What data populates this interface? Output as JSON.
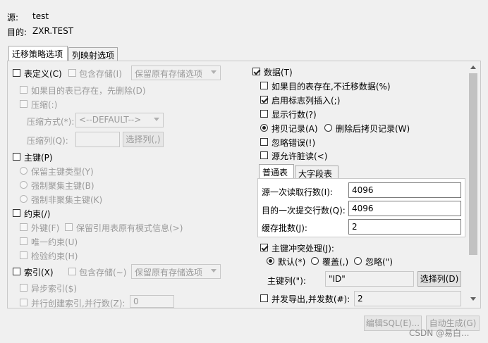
{
  "header": {
    "source_label": "源:",
    "source_value": "test",
    "target_label": "目的:",
    "target_value": "ZXR.TEST"
  },
  "tabs": [
    "迁移策略选项",
    "列映射选项"
  ],
  "left": {
    "table_def": "表定义(C)",
    "include_storage": "包含存储(I)",
    "keep_storage_option": "保留原有存储选项",
    "drop_if_exists": "如果目的表已存在，先删除(D)",
    "compress": "压缩(:)",
    "compress_method_label": "压缩方式(*):",
    "compress_method_value": "<--DEFAULT-->",
    "compress_col_label": "压缩列(Q):",
    "select_col_btn": "选择列(,)",
    "primary_key": "主键(P)",
    "keep_pk_type": "保留主键类型(Y)",
    "force_cluster_pk": "强制聚集主键(B)",
    "force_noncluster_pk": "强制非聚集主键(K)",
    "constraint": "约束(/)",
    "foreign_key": "外键(F)",
    "keep_ref_schema": "保留引用表原有模式信息(>)",
    "unique": "唯一约束(U)",
    "check": "检验约束(H)",
    "index": "索引(X)",
    "index_include_storage": "包含存储(~)",
    "index_storage_option": "保留原有存储选项",
    "async_index": "异步索引($)",
    "parallel_index": "并行创建索引,并行数(Z):",
    "parallel_index_value": "0"
  },
  "right": {
    "data": "数据(T)",
    "skip_if_exists": "如果目的表存在,不迁移数据(%)",
    "identity_insert": "启用标志列插入(;)",
    "show_rows": "显示行数(?)",
    "copy_records": "拷贝记录(A)",
    "delete_then_copy": "删除后拷贝记录(W)",
    "ignore_errors": "忽略错误(!)",
    "dirty_read": "源允许脏读(<)",
    "subtabs": [
      "普通表",
      "大字段表"
    ],
    "read_rows_label": "源一次读取行数(I):",
    "read_rows_value": "4096",
    "commit_rows_label": "目的一次提交行数(Q):",
    "commit_rows_value": "4096",
    "cache_batches_label": "缓存批数(J):",
    "cache_batches_value": "2",
    "pk_conflict": "主键冲突处理(J):",
    "pk_default": "默认(*)",
    "pk_overwrite": "覆盖(,)",
    "pk_ignore": "忽略(\")",
    "pk_col_label": "主键列(\"):",
    "pk_col_value": "\"ID\"",
    "pk_select_btn": "选择列(D)",
    "parallel_export": "并发导出,并发数(#):",
    "parallel_export_value": "2"
  },
  "footer": {
    "edit_sql": "编辑SQL(E)...",
    "auto_gen": "自动生成(G)",
    "watermark": "CSDN @易白..."
  }
}
